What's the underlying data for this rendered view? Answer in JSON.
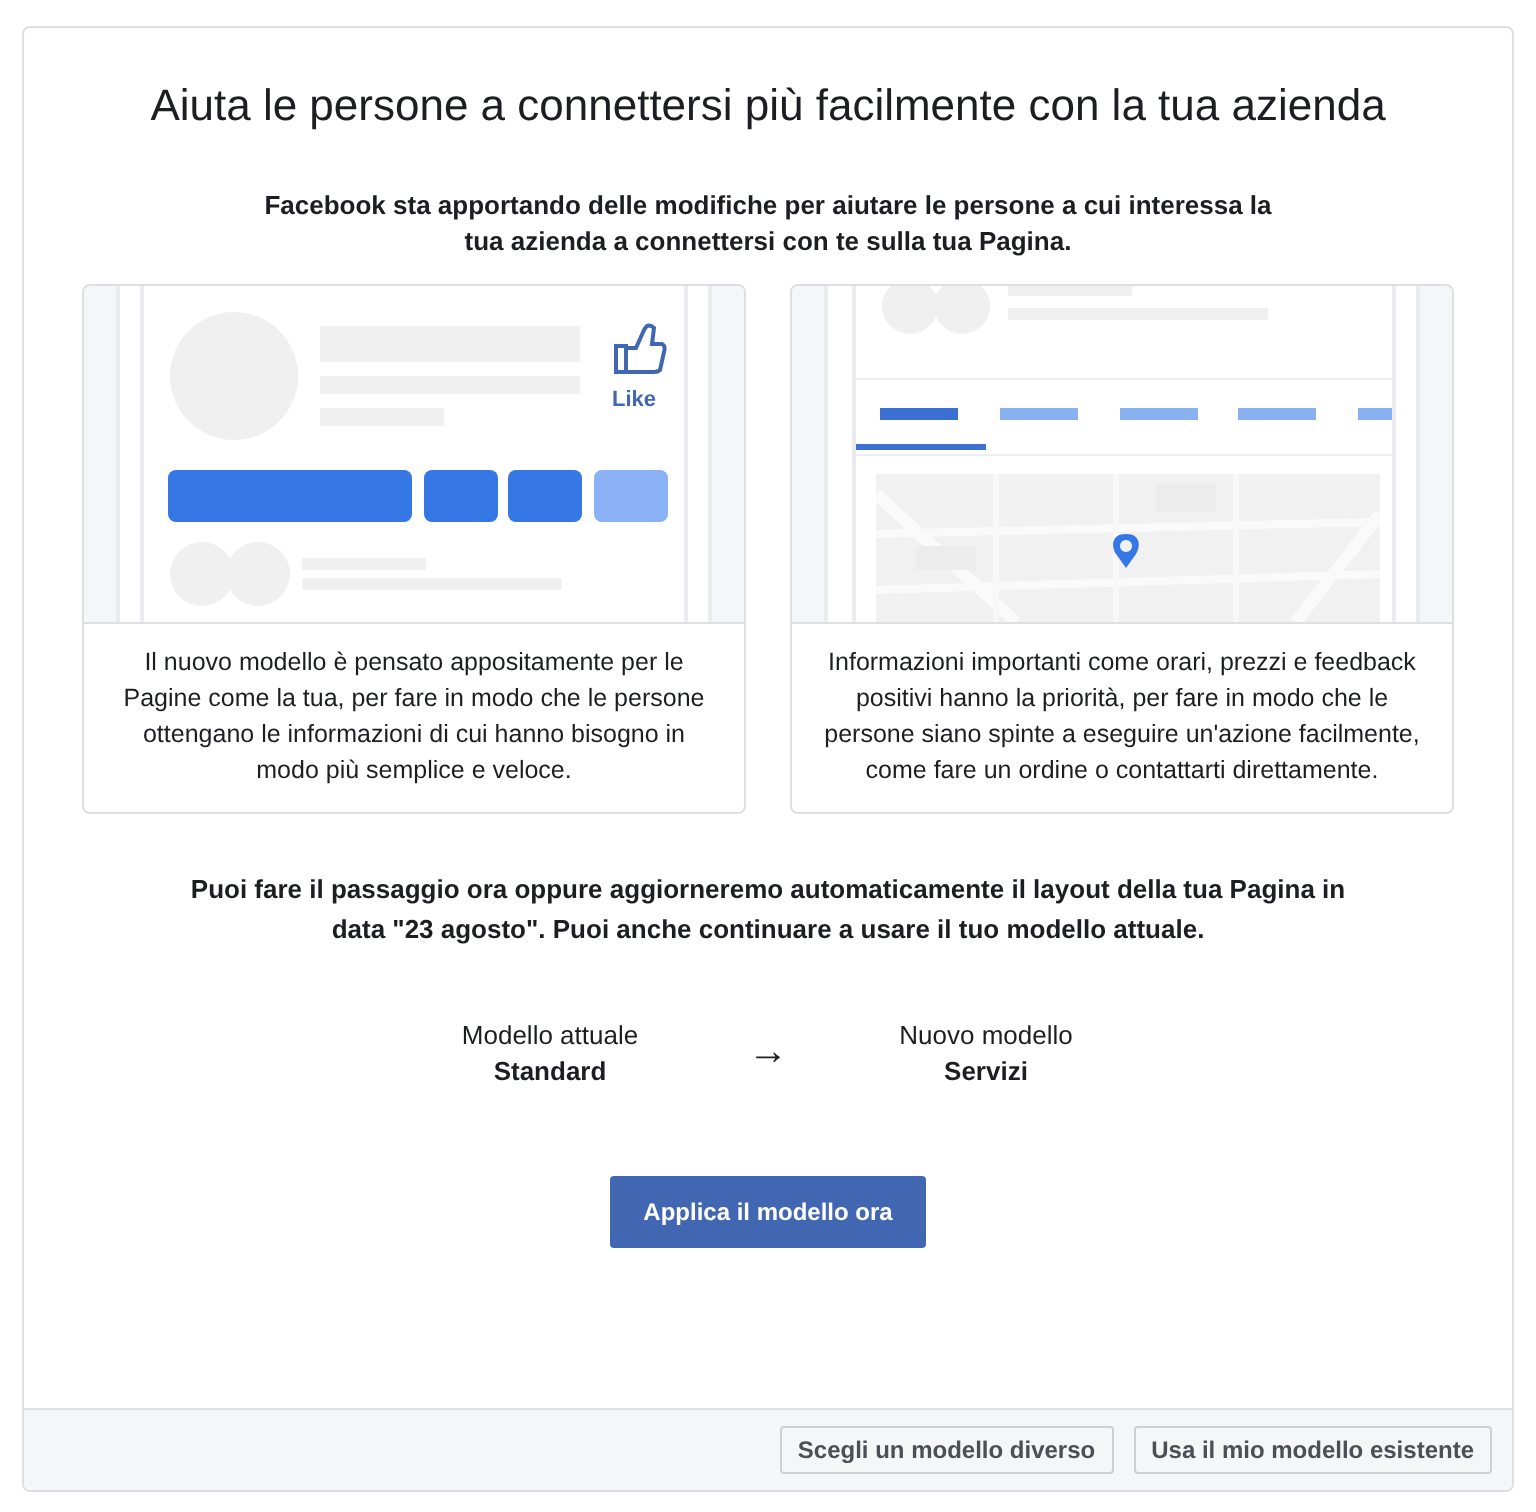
{
  "title": "Aiuta le persone a connettersi più facilmente con la tua azienda",
  "intro": "Facebook sta apportando delle modifiche per aiutare le persone a cui interessa la tua azienda a connettersi con te sulla tua Pagina.",
  "panels": [
    {
      "kind": "page-preview",
      "like_label": "Like",
      "text": "Il nuovo modello è pensato appositamente per le Pagine come la tua, per fare in modo che le persone ottengano le informazioni di cui hanno bisogno in modo più semplice e veloce."
    },
    {
      "kind": "map-preview",
      "text": "Informazioni importanti come orari, prezzi e feedback positivi hanno la priorità, per fare in modo che le persone siano spinte a eseguire un'azione facilmente, come fare un ordine o contattarti direttamente."
    }
  ],
  "notice": "Puoi fare il passaggio ora oppure aggiorneremo automaticamente il layout della tua Pagina in data \"23 agosto\". Puoi anche continuare a usare il tuo modello attuale.",
  "comparison": {
    "current": {
      "label": "Modello attuale",
      "value": "Standard"
    },
    "arrow": "→",
    "new": {
      "label": "Nuovo modello",
      "value": "Servizi"
    }
  },
  "apply_button": "Applica il modello ora",
  "footer_buttons": [
    "Scegli un modello diverso",
    "Usa il mio modello esistente"
  ]
}
